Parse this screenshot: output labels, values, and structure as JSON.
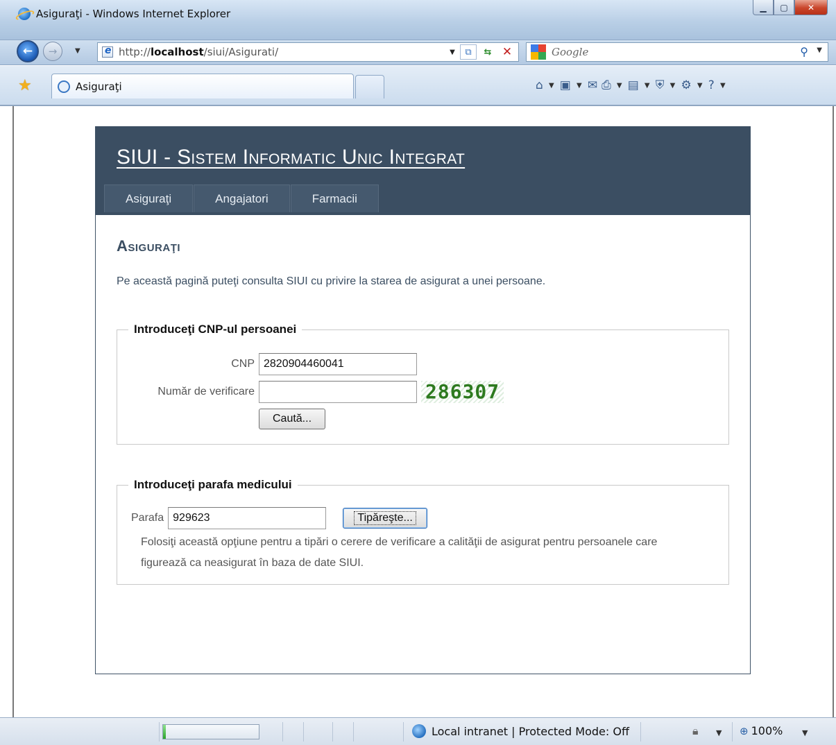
{
  "window": {
    "title": "Asiguraţi - Windows Internet Explorer"
  },
  "address": {
    "prefix": "http://",
    "host": "localhost",
    "path": "/siui/Asigurati/"
  },
  "search": {
    "placeholder": "Google"
  },
  "tab": {
    "label": "Asiguraţi"
  },
  "site": {
    "title": "SIUI - Sistem Informatic Unic Integrat",
    "menu": [
      {
        "label": "Asiguraţi"
      },
      {
        "label": "Angajatori"
      },
      {
        "label": "Farmacii"
      }
    ],
    "heading": "Asiguraţi",
    "description": "Pe această pagină puteţi consulta SIUI cu privire la starea de asigurat a unei persoane."
  },
  "cnp_form": {
    "legend": "Introduceţi CNP-ul persoanei",
    "cnp_label": "CNP",
    "cnp_value": "2820904460041",
    "verify_label": "Număr de verificare",
    "verify_value": "",
    "captcha": "286307",
    "submit_label": "Caută..."
  },
  "parafa_form": {
    "legend": "Introduceţi parafa medicului",
    "parafa_label": "Parafa",
    "parafa_value": "929623",
    "print_label": "Tipăreşte...",
    "help": "Folosiţi această opţiune pentru a tipări o cerere de verificare a calităţii de asigurat pentru persoanele care figurează ca neasigurat în baza de date SIUI."
  },
  "status": {
    "zone": "Local intranet | Protected Mode: Off",
    "zoom": "100%",
    "progress": 0.03
  },
  "colors": {
    "header": "#3b4e62",
    "captcha": "#2d7a1f",
    "accent": "#1a58b2"
  }
}
